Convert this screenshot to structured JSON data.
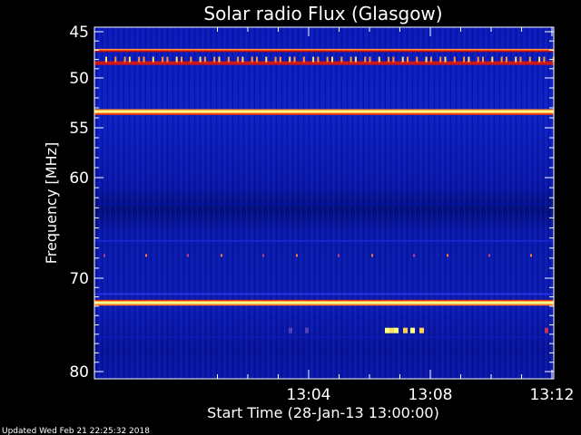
{
  "chart_data": {
    "type": "heatmap",
    "title": "Solar radio Flux (Glasgow)",
    "ylabel": "Frequency [MHz]",
    "xlabel": "Start Time (28-Jan-13 13:00:00)",
    "ylim": [
      45,
      80
    ],
    "xlim": [
      "13:00:00",
      "13:15:00"
    ],
    "y_ticks": [
      {
        "label": "45",
        "value": 45
      },
      {
        "label": "50",
        "value": 50
      },
      {
        "label": "55",
        "value": 55
      },
      {
        "label": "60",
        "value": 60
      },
      {
        "label": "70",
        "value": 70
      },
      {
        "label": "80",
        "value": 80
      }
    ],
    "x_ticks": [
      {
        "label": "13:04",
        "value": 4
      },
      {
        "label": "13:08",
        "value": 8
      },
      {
        "label": "13:12",
        "value": 12
      }
    ],
    "colormap": [
      "#000033",
      "#0010a0",
      "#2040e0",
      "#e02020",
      "#ffa000",
      "#ffff80"
    ],
    "background_color": "#000000",
    "bands": [
      {
        "freq_mhz": 47.0,
        "intensity": "strong-red-orange"
      },
      {
        "freq_mhz": 48.0,
        "intensity": "intermittent-bright"
      },
      {
        "freq_mhz": 53.4,
        "intensity": "very-strong-yellow"
      },
      {
        "freq_mhz": 72.6,
        "intensity": "very-strong-yellow"
      }
    ]
  },
  "footer": {
    "updated": "Updated Wed Feb 21 22:25:32 2018"
  }
}
